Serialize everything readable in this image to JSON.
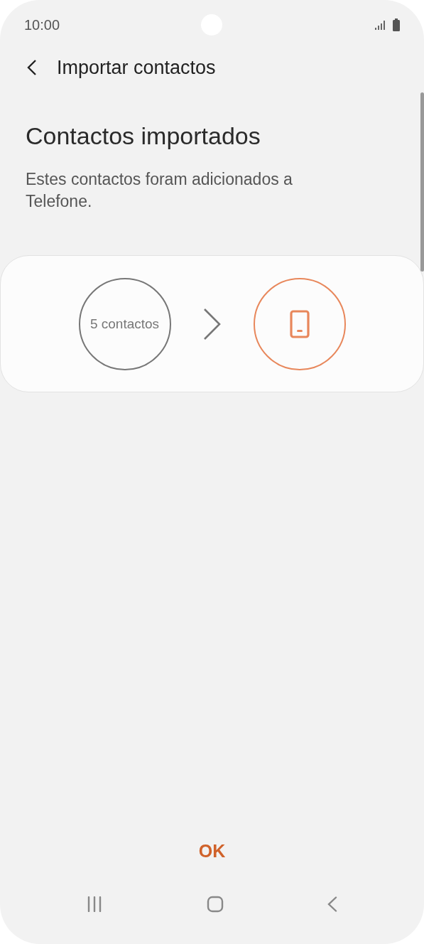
{
  "status_bar": {
    "time": "10:00"
  },
  "header": {
    "title": "Importar contactos"
  },
  "heading": "Contactos importados",
  "description": "Estes contactos foram adicionados a Telefone.",
  "transfer": {
    "source": "5 contactos"
  },
  "buttons": [
    "OK"
  ]
}
